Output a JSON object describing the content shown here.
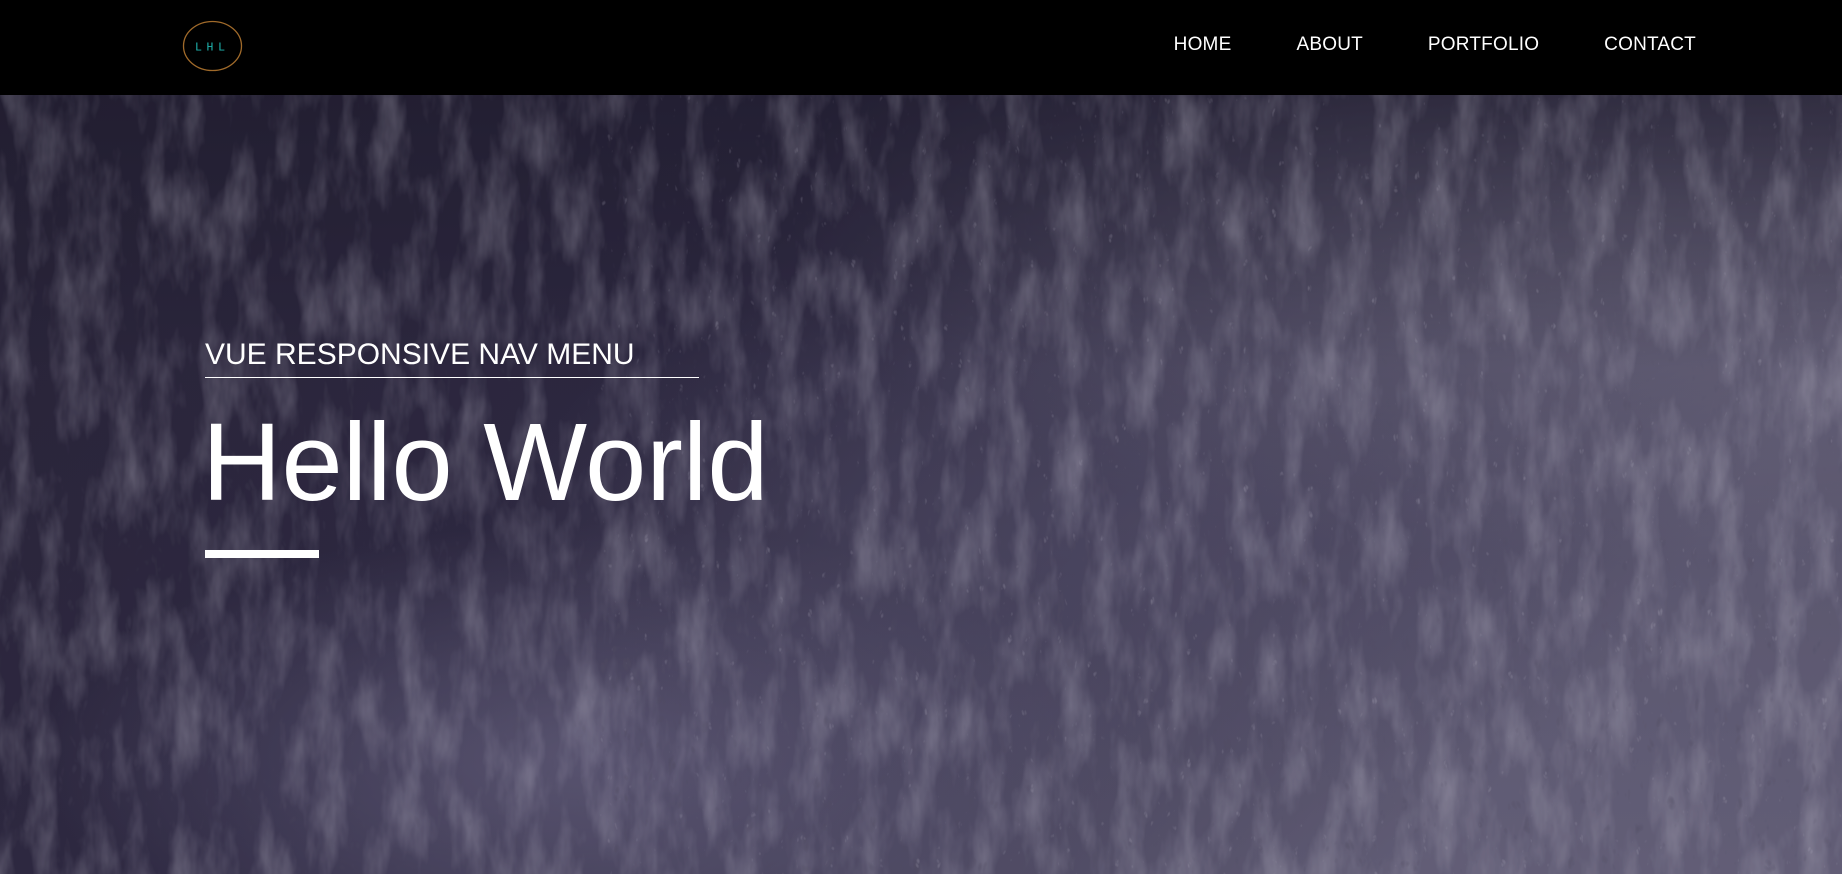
{
  "logo": {
    "text": "LHL",
    "ring_color": "#a06a2a",
    "text_color": "#1fb5b0"
  },
  "nav": {
    "items": [
      {
        "label": "HOME"
      },
      {
        "label": "ABOUT"
      },
      {
        "label": "PORTFOLIO"
      },
      {
        "label": "CONTACT"
      }
    ]
  },
  "hero": {
    "subtitle": "VUE RESPONSIVE NAV MENU",
    "title": "Hello World",
    "background_color": "#3e3a52"
  }
}
